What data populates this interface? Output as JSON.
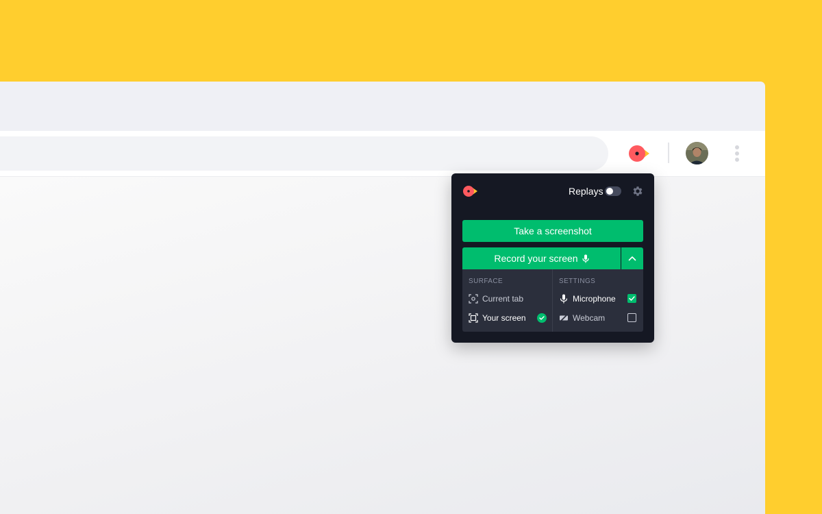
{
  "popup": {
    "replays_label": "Replays",
    "replays_enabled": false,
    "take_screenshot_label": "Take a screenshot",
    "record_label": "Record your screen",
    "surface": {
      "heading": "SURFACE",
      "options": [
        {
          "label": "Current tab",
          "selected": false
        },
        {
          "label": "Your screen",
          "selected": true
        }
      ]
    },
    "settings": {
      "heading": "SETTINGS",
      "options": [
        {
          "label": "Microphone",
          "checked": true
        },
        {
          "label": "Webcam",
          "checked": false
        }
      ]
    }
  },
  "icons": {
    "extension": "bird-logo-icon",
    "settings": "gear-icon",
    "microphone": "microphone-icon",
    "expand": "chevron-up-icon",
    "current_tab": "tab-capture-icon",
    "your_screen": "screen-capture-icon",
    "webcam": "webcam-off-icon",
    "menu": "kebab-menu-icon"
  },
  "colors": {
    "page_background": "#FFCE2E",
    "accent_green": "#00BD6E",
    "popup_background": "#151823",
    "options_background": "#2B2F3C",
    "logo_red": "#FF5A5F",
    "logo_yellow": "#FFC02E"
  }
}
